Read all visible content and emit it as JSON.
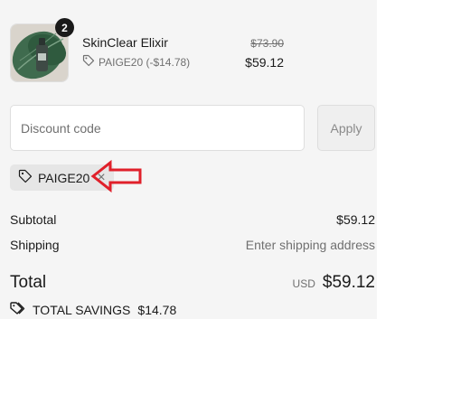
{
  "product": {
    "quantity": "2",
    "name": "SkinClear Elixir",
    "discount_label": "PAIGE20 (-$14.78)",
    "price_original": "$73.90",
    "price_discounted": "$59.12"
  },
  "discount": {
    "placeholder": "Discount code",
    "apply_label": "Apply",
    "applied_code": "PAIGE20",
    "remove_glyph": "×"
  },
  "summary": {
    "subtotal_label": "Subtotal",
    "subtotal_value": "$59.12",
    "shipping_label": "Shipping",
    "shipping_value": "Enter shipping address",
    "total_label": "Total",
    "currency": "USD",
    "total_value": "$59.12",
    "savings_label": "TOTAL SAVINGS",
    "savings_value": "$14.78"
  },
  "colors": {
    "panel_bg": "#f5f5f5",
    "annotation_arrow": "#e0202a",
    "muted_text": "#707070"
  },
  "icons": [
    "tag-icon",
    "close-icon",
    "annotation-arrow-icon"
  ]
}
